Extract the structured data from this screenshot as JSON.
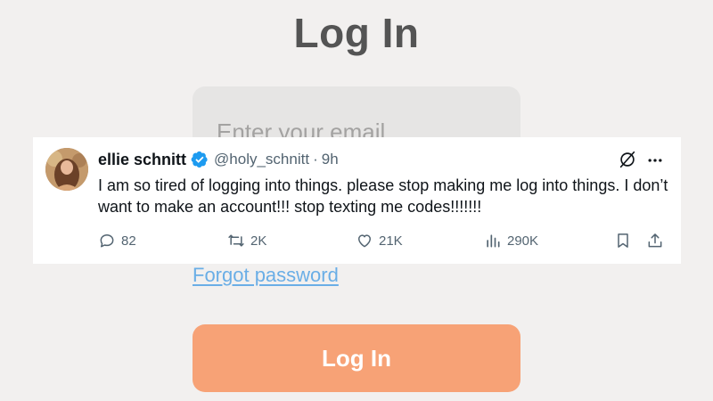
{
  "login": {
    "title": "Log In",
    "email_placeholder": "Enter your email",
    "forgot_password": "Forgot password",
    "button_label": "Log In"
  },
  "tweet": {
    "display_name": "ellie schnitt",
    "verified": true,
    "handle": "@holy_schnitt",
    "separator": "·",
    "time": "9h",
    "text": "I am so tired of logging into things. please stop making me log into things. I don’t want to make an account!!! stop texting me codes!!!!!!!",
    "stats": {
      "replies": "82",
      "reposts": "2K",
      "likes": "21K",
      "views": "290K"
    },
    "icons": [
      "verified-icon",
      "grok-icon",
      "more-icon",
      "reply-icon",
      "repost-icon",
      "like-icon",
      "views-icon",
      "bookmark-icon",
      "share-icon"
    ]
  },
  "colors": {
    "page_background": "#f2f0ef",
    "title_text": "#545454",
    "input_background": "#e6e5e4",
    "link": "#6aaee6",
    "login_button": "#f7a276",
    "verified_blue": "#1d9bf0",
    "tweet_secondary_text": "#536471"
  }
}
